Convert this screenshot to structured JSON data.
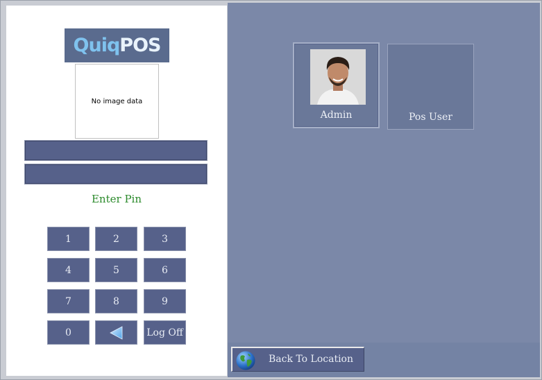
{
  "login": {
    "logo": {
      "part1": "Quiq",
      "part2": "POS"
    },
    "photo_placeholder": "No image data",
    "enter_pin_label": "Enter Pin",
    "keypad": {
      "keys": [
        "1",
        "2",
        "3",
        "4",
        "5",
        "6",
        "7",
        "8",
        "9",
        "0"
      ],
      "log_off_label": "Log Off",
      "backspace_icon": "back-arrow-icon"
    }
  },
  "users": [
    {
      "name": "Admin",
      "selected": true
    },
    {
      "name": "Pos User",
      "selected": false
    }
  ],
  "footer": {
    "back_to_location_label": "Back To Location"
  },
  "colors": {
    "panel_bg": "#7b88a8",
    "button_bg": "#56618a",
    "enter_pin_text": "#2b8a2b",
    "logo_bg": "#5a6b8e"
  }
}
